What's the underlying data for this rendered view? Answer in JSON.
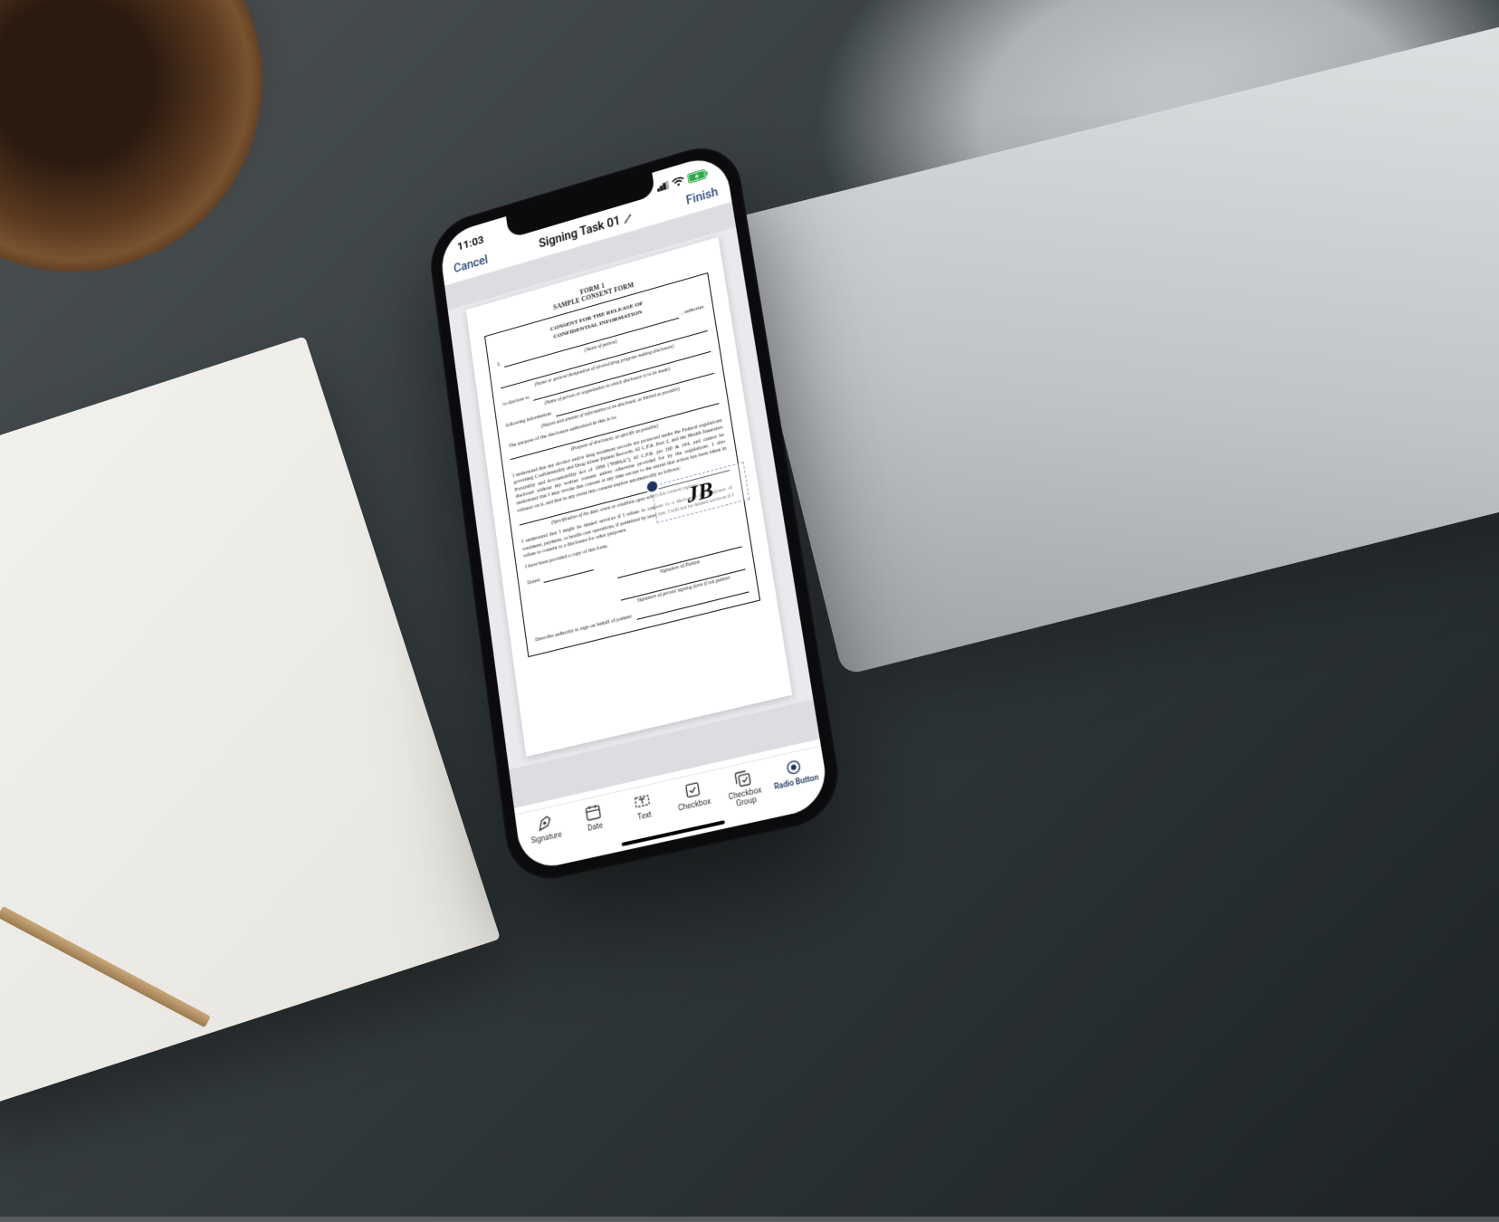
{
  "status": {
    "time": "11:03",
    "signal_icon": "signal-icon",
    "wifi_icon": "wifi-icon",
    "battery_icon": "battery-charging-icon"
  },
  "nav": {
    "cancel": "Cancel",
    "title": "Signing Task 01",
    "edit_icon": "pencil-icon",
    "finish": "Finish"
  },
  "document": {
    "form_no": "FORM 1",
    "form_title": "SAMPLE CONSENT FORM",
    "section_title_1": "CONSENT FOR THE RELEASE OF",
    "section_title_2": "CONFIDENTIAL INFORMATION",
    "lead_i": "I,",
    "lead_trail": ", authorize",
    "cap_name_patient": "(Name of patient)",
    "cap_program": "(Name or general designation of alcohol/drug program making disclosure)",
    "to_disclose": "to disclose to",
    "cap_recipient": "(Name of person or organization to which disclosure is to be made)",
    "following_info": "following information:",
    "cap_nature": "(Nature and amount of information to be disclosed, as limited as possible)",
    "purpose": "The purpose of the disclosure authorized in this is to:",
    "cap_purpose": "(Purpose of disclosure, as specific as possible)",
    "para1": "I understand that my alcohol and/or drug treatment records are protected under the Federal regulations governing Confidentiality and Drug Abuse Patient Records, 42 C.F.R. Part 2, and the Health Insurance Portability and Accountability Act of 1996 (\"HIPAA\"), 45 C.F.R. pts 160 & 164, and cannot be disclosed without my written consent unless otherwise provided for by the regulations. I also understand that I may revoke this consent at any time except to the extent that action has been taken in reliance on it, and that in any event this consent expires automatically as follows:",
    "cap_spec": "(Specification of the date, event or condition upon which this consent expires)",
    "para2": "I understand that I might be denied services if I refuse to consent to a disclosure for purposes of treatment, payment, or health care operations, if permitted by state law. I will not be denied services if I refuse to consent to a disclosure for other purposes.",
    "copy": "I have been provided a copy of this form.",
    "dated": "Dated:",
    "sig_patient": "Signature of Patient",
    "sig_other": "Signature of person signing form if not patient",
    "describe": "Describe authority to sign on behalf of patient:",
    "signature_mark": "JB"
  },
  "toolbar": {
    "items": [
      {
        "key": "signature",
        "label": "Signature",
        "icon": "pen-nib-icon"
      },
      {
        "key": "date",
        "label": "Date",
        "icon": "calendar-icon"
      },
      {
        "key": "text",
        "label": "Text",
        "icon": "text-box-icon"
      },
      {
        "key": "checkbox",
        "label": "Checkbox",
        "icon": "checkbox-icon"
      },
      {
        "key": "checkbox_group",
        "label": "Checkbox Group",
        "icon": "checkbox-group-icon"
      },
      {
        "key": "radio_button",
        "label": "Radio Button",
        "icon": "radio-button-icon"
      }
    ],
    "active_key": "radio_button"
  }
}
